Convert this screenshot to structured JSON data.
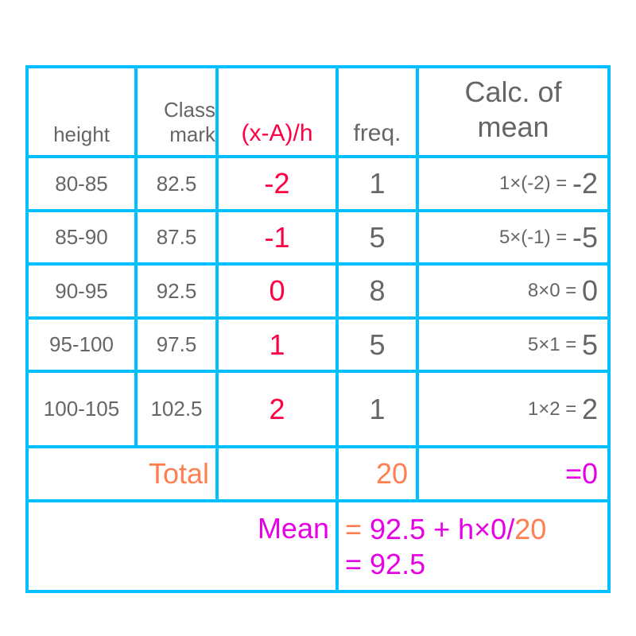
{
  "colors": {
    "border": "#00bfff",
    "text_gray": "#666666",
    "deviation_red": "#ff0044",
    "total_orange": "#ff7f50",
    "result_magenta": "#e600e6"
  },
  "header": {
    "height": "height",
    "class_mark_line1": "Class",
    "class_mark_line2": "mark",
    "deviation": "(x-A)/h",
    "freq": "freq.",
    "calc_line1": "Calc. of",
    "calc_line2": "mean"
  },
  "rows": [
    {
      "height": "80-85",
      "class_mark": "82.5",
      "deviation": "-2",
      "freq": "1",
      "calc_expr": "1×(-2) = ",
      "calc_result": "-2"
    },
    {
      "height": "85-90",
      "class_mark": "87.5",
      "deviation": "-1",
      "freq": "5",
      "calc_expr": "5×(-1) = ",
      "calc_result": "-5"
    },
    {
      "height": "90-95",
      "class_mark": "92.5",
      "deviation": "0",
      "freq": "8",
      "calc_expr": "8×0 = ",
      "calc_result": "0"
    },
    {
      "height": "95-100",
      "class_mark": "97.5",
      "deviation": "1",
      "freq": "5",
      "calc_expr": "5×1 = ",
      "calc_result": "5"
    },
    {
      "height": "100-105",
      "class_mark": "102.5",
      "deviation": "2",
      "freq": "1",
      "calc_expr": "1×2 = ",
      "calc_result": "2"
    }
  ],
  "total": {
    "label": "Total",
    "freq_sum": "20",
    "calc_sum": "=0"
  },
  "mean": {
    "label": "Mean",
    "line1_eq": "= ",
    "line1_expr": "92.5 + h×0/",
    "line1_denominator": "20",
    "line2": "= 92.5"
  }
}
